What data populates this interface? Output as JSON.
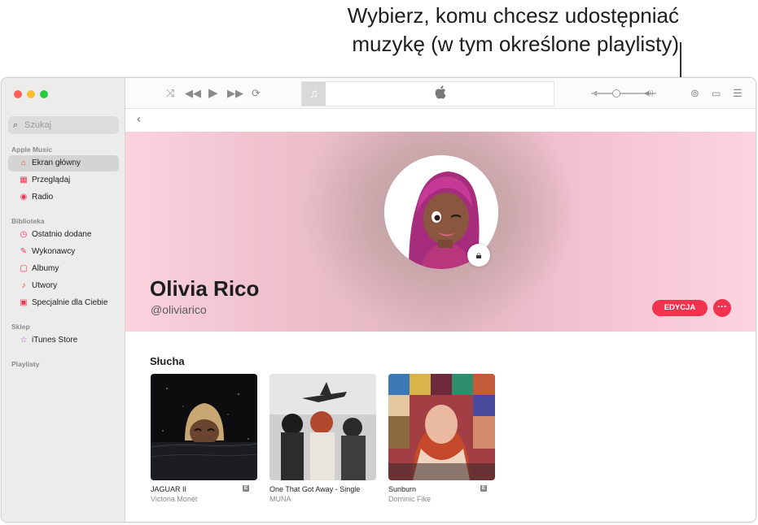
{
  "callout": {
    "line1": "Wybierz, komu chcesz udostępniać",
    "line2": "muzykę (w tym określone playlisty)"
  },
  "sidebar": {
    "search_placeholder": "Szukaj",
    "sections": {
      "apple_music": "Apple Music",
      "library": "Biblioteka",
      "store": "Sklep",
      "playlists": "Playlisty"
    },
    "apple_music_items": [
      {
        "label": "Ekran główny",
        "icon": "home-icon"
      },
      {
        "label": "Przeglądaj",
        "icon": "grid-icon"
      },
      {
        "label": "Radio",
        "icon": "radio-icon"
      }
    ],
    "library_items": [
      {
        "label": "Ostatnio dodane",
        "icon": "clock-icon"
      },
      {
        "label": "Wykonawcy",
        "icon": "microphone-icon"
      },
      {
        "label": "Albumy",
        "icon": "album-icon"
      },
      {
        "label": "Utwory",
        "icon": "note-icon"
      },
      {
        "label": "Specjalnie dla Ciebie",
        "icon": "person-icon"
      }
    ],
    "store_items": [
      {
        "label": "iTunes Store",
        "icon": "star-icon"
      }
    ]
  },
  "profile": {
    "name": "Olivia Rico",
    "handle": "@oliviarico",
    "edit_label": "EDYCJA",
    "more_label": "···"
  },
  "listening": {
    "title": "Słucha",
    "albums": [
      {
        "title": "JAGUAR II",
        "artist": "Victoria Monét",
        "explicit": true
      },
      {
        "title": "One That Got Away - Single",
        "artist": "MUNA",
        "explicit": false
      },
      {
        "title": "Sunburn",
        "artist": "Dominic Fike",
        "explicit": true
      }
    ],
    "explicit_badge": "E"
  },
  "colors": {
    "accent": "#f2334f",
    "sidebar_bg": "#ececec"
  }
}
